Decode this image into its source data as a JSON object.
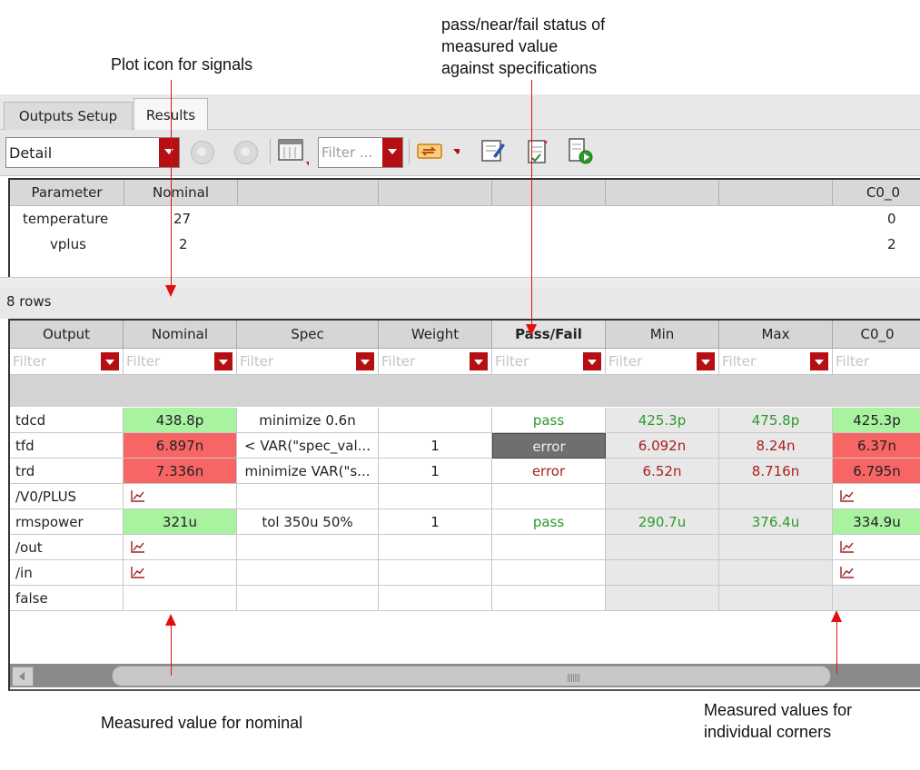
{
  "annotations": {
    "plot_icon": "Plot icon for signals",
    "status_line1": "pass/near/fail status of",
    "status_line2": "measured value",
    "status_line3": "against specifications",
    "nominal": "Measured value for nominal",
    "corners_line1": "Measured values for",
    "corners_line2": "individual corners"
  },
  "tabs": [
    "Outputs Setup",
    "Results"
  ],
  "toolbar": {
    "view_select": "Detail",
    "filter_placeholder": "Filter ..."
  },
  "params": {
    "headers": [
      "Parameter",
      "Nominal",
      "",
      "",
      "",
      "",
      "",
      "C0_0"
    ],
    "rows": [
      {
        "name": "temperature",
        "nominal": "27",
        "corner": "0"
      },
      {
        "name": "vplus",
        "nominal": "2",
        "corner": "2"
      }
    ]
  },
  "rows_count": "8 rows",
  "results": {
    "headers": [
      "Output",
      "Nominal",
      "Spec",
      "Weight",
      "Pass/Fail",
      "Min",
      "Max",
      "C0_0"
    ],
    "filter_placeholder": "Filter",
    "rows": [
      {
        "output": "tdcd",
        "nominal": "438.8p",
        "spec": "minimize 0.6n",
        "weight": "",
        "status": "pass",
        "min": "425.3p",
        "max": "475.8p",
        "corner": "425.3p"
      },
      {
        "output": "tfd",
        "nominal": "6.897n",
        "spec": "< VAR(\"spec_val...",
        "weight": "1",
        "status": "error",
        "min": "6.092n",
        "max": "8.24n",
        "corner": "6.37n"
      },
      {
        "output": "trd",
        "nominal": "7.336n",
        "spec": "minimize VAR(\"s...",
        "weight": "1",
        "status": "error",
        "min": "6.52n",
        "max": "8.716n",
        "corner": "6.795n"
      },
      {
        "output": "/V0/PLUS",
        "nominal": "",
        "spec": "",
        "weight": "",
        "status": "",
        "min": "",
        "max": "",
        "corner": ""
      },
      {
        "output": "rmspower",
        "nominal": "321u",
        "spec": "tol 350u 50%",
        "weight": "1",
        "status": "pass",
        "min": "290.7u",
        "max": "376.4u",
        "corner": "334.9u"
      },
      {
        "output": "/out",
        "nominal": "",
        "spec": "",
        "weight": "",
        "status": "",
        "min": "",
        "max": "",
        "corner": ""
      },
      {
        "output": "/in",
        "nominal": "",
        "spec": "",
        "weight": "",
        "status": "",
        "min": "",
        "max": "",
        "corner": ""
      },
      {
        "output": "false",
        "nominal": "",
        "spec": "",
        "weight": "",
        "status": "",
        "min": "",
        "max": "",
        "corner": ""
      }
    ]
  },
  "colors": {
    "pass_bg": "#a8f2a0",
    "fail_bg": "#f86565",
    "pass_text": "#2b9a2b",
    "fail_text": "#a82020",
    "arrow": "#e01010",
    "dropdown": "#b50f14"
  }
}
